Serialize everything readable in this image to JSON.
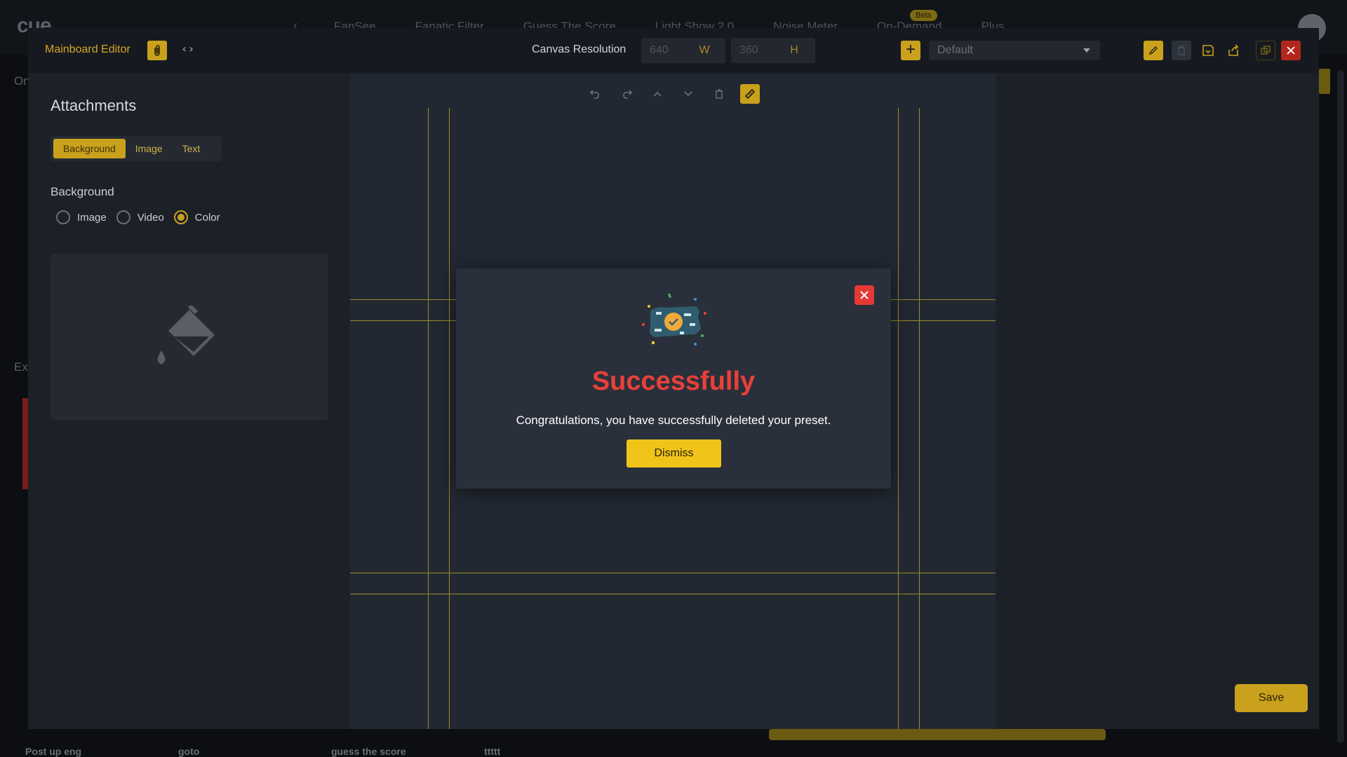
{
  "background_app": {
    "logo": "cue",
    "nav_tabs": [
      "FanSee",
      "Fanatic Filter",
      "Guess The Score",
      "Light Show 2.0",
      "Noise Meter",
      "On-Demand",
      "Plus"
    ],
    "beta_badge": "Beta",
    "left_labels": [
      "On",
      "Ex"
    ],
    "bottom_labels": [
      "Post up eng",
      "goto",
      "guess the score",
      "ttttt"
    ]
  },
  "editor": {
    "title": "Mainboard Editor",
    "clip_icon": "paperclip-icon",
    "code_icon": "code-icon",
    "canvas_resolution_label": "Canvas Resolution",
    "width_value": "640",
    "width_unit": "W",
    "height_value": "360",
    "height_unit": "H",
    "preset_select": "Default",
    "toolbar_icons": [
      "edit-icon",
      "delete-icon",
      "save-preset-icon",
      "share-icon",
      "duplicate-icon",
      "close-icon"
    ],
    "save_label": "Save"
  },
  "attachments": {
    "title": "Attachments",
    "tabs": [
      {
        "label": "Background",
        "active": true
      },
      {
        "label": "Image",
        "active": false
      },
      {
        "label": "Text",
        "active": false
      }
    ],
    "section_label": "Background",
    "radio_options": [
      {
        "label": "Image",
        "selected": false
      },
      {
        "label": "Video",
        "selected": false
      },
      {
        "label": "Color",
        "selected": true
      }
    ],
    "swatch_icon": "paint-bucket-icon"
  },
  "canvas_tools": [
    "undo-icon",
    "redo-icon",
    "move-up-icon",
    "move-down-icon",
    "trash-icon",
    "ruler-icon"
  ],
  "modal": {
    "title": "Successfully",
    "message": "Congratulations, you have successfully deleted your preset.",
    "dismiss_label": "Dismiss"
  },
  "colors": {
    "accent": "#c9a11c",
    "success_title": "#e84038",
    "close_red": "#e53935"
  }
}
